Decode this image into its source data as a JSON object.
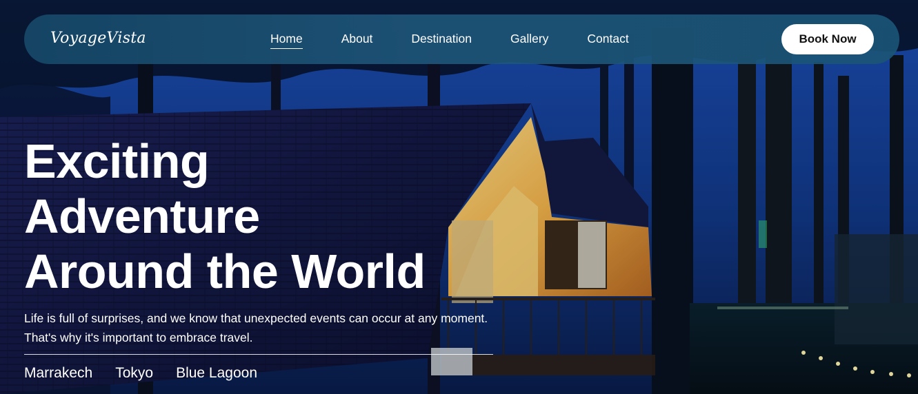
{
  "brand": {
    "logo": "VoyageVista"
  },
  "nav": {
    "items": [
      {
        "label": "Home",
        "active": true
      },
      {
        "label": "About"
      },
      {
        "label": "Destination"
      },
      {
        "label": "Gallery"
      },
      {
        "label": "Contact"
      }
    ],
    "cta_label": "Book Now"
  },
  "hero": {
    "headline_lines": [
      "Exciting",
      "Adventure",
      "Around the World"
    ],
    "tagline": "Life is full of surprises, and we know that unexpected events can occur at any moment. That's why it's important to embrace travel.",
    "places": [
      "Marrakech",
      "Tokyo",
      "Blue Lagoon"
    ]
  },
  "colors": {
    "nav_bg": "#1a5476",
    "sky": "#1a4fb0",
    "roof": "#141a4a",
    "cabin_glow": "#f0b848",
    "button_bg": "#ffffff"
  }
}
